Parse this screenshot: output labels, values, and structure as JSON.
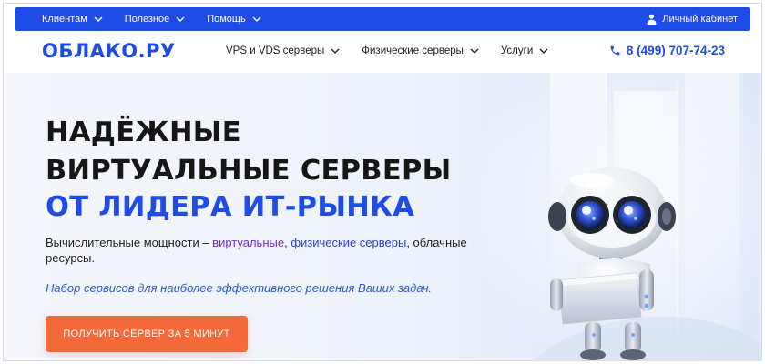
{
  "topbar": {
    "items": [
      {
        "label": "Клиентам"
      },
      {
        "label": "Полезное"
      },
      {
        "label": "Помощь"
      }
    ],
    "cabinet_label": "Личный кабинет"
  },
  "header": {
    "logo": "ОБЛАКО.РУ",
    "nav": [
      {
        "label": "VPS и VDS серверы"
      },
      {
        "label": "Физические серверы"
      },
      {
        "label": "Услуги"
      }
    ],
    "phone": "8 (499) 707-74-23"
  },
  "hero": {
    "title_line1": "НАДЁЖНЫЕ",
    "title_line2": "ВИРТУАЛЬНЫЕ СЕРВЕРЫ",
    "title_line3": "ОТ ЛИДЕРА ИТ-РЫНКА",
    "sub_prefix": "Вычислительные мощности – ",
    "sub_virtual": "виртуальные",
    "sub_comma": ", ",
    "sub_physical": "физические серверы",
    "sub_suffix": ", облачные ресурсы.",
    "tagline": "Набор сервисов для наиболее эффективного решения Ваших задач.",
    "cta_label": "ПОЛУЧИТЬ СЕРВЕР ЗА 5 МИНУТ"
  },
  "colors": {
    "brand_blue": "#1f4ce8",
    "cta_orange": "#f4693b"
  },
  "icons": {
    "user": "user-icon",
    "phone": "phone-icon",
    "chevron": "chevron-down-icon"
  }
}
